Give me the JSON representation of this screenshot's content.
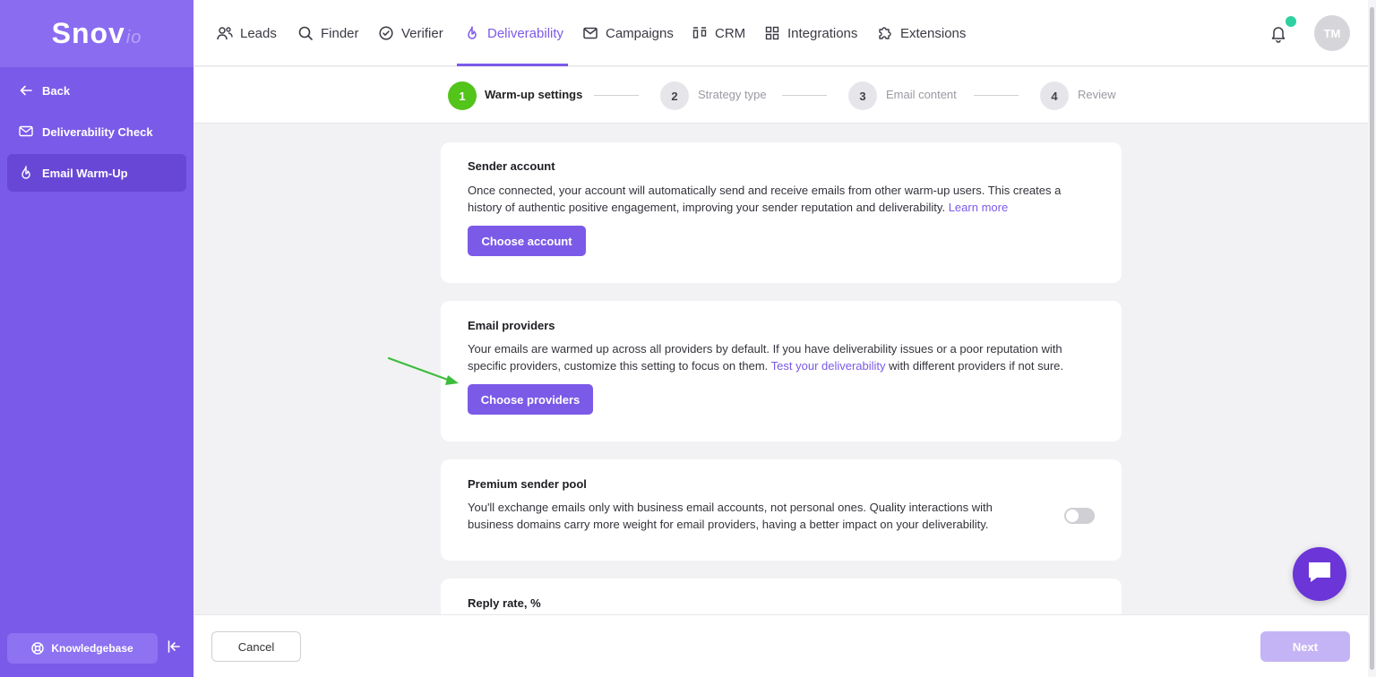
{
  "sidebar": {
    "logo_main": "Snov",
    "logo_suffix": "io",
    "items": [
      {
        "label": "Back",
        "icon": "arrow-left-icon"
      },
      {
        "label": "Deliverability Check",
        "icon": "mail-check-icon"
      },
      {
        "label": "Email Warm-Up",
        "icon": "flame-icon"
      }
    ],
    "knowledgebase_label": "Knowledgebase"
  },
  "nav": {
    "items": [
      {
        "label": "Leads",
        "icon": "users-icon"
      },
      {
        "label": "Finder",
        "icon": "search-icon"
      },
      {
        "label": "Verifier",
        "icon": "check-circle-icon"
      },
      {
        "label": "Deliverability",
        "icon": "flame-icon"
      },
      {
        "label": "Campaigns",
        "icon": "mail-icon"
      },
      {
        "label": "CRM",
        "icon": "crm-icon"
      },
      {
        "label": "Integrations",
        "icon": "grid-icon"
      },
      {
        "label": "Extensions",
        "icon": "puzzle-icon"
      }
    ],
    "active": "Deliverability",
    "avatar_initials": "TM"
  },
  "stepper": [
    {
      "number": "1",
      "label": "Warm-up settings"
    },
    {
      "number": "2",
      "label": "Strategy type"
    },
    {
      "number": "3",
      "label": "Email content"
    },
    {
      "number": "4",
      "label": "Review"
    }
  ],
  "sender_account": {
    "title": "Sender account",
    "description": "Once connected, your account will automatically send and receive emails from other warm-up users. This creates a history of authentic positive engagement, improving your sender reputation and deliverability.",
    "link": "Learn more",
    "button": "Choose account"
  },
  "email_providers": {
    "title": "Email providers",
    "description_before": "Your emails are warmed up across all providers by default. If you have deliverability issues or a poor reputation with specific providers, customize this setting to focus on them.",
    "link": "Test your deliverability",
    "description_after": "with different providers if not sure.",
    "button": "Choose providers"
  },
  "premium_pool": {
    "title": "Premium sender pool",
    "description": "You'll exchange emails only with business email accounts, not personal ones. Quality interactions with business domains carry more weight for email providers, having a better impact on your deliverability.",
    "enabled": false
  },
  "reply_rate": {
    "title": "Reply rate, %"
  },
  "footer": {
    "cancel": "Cancel",
    "next": "Next"
  },
  "colors": {
    "accent": "#7b5ae8",
    "sidebar": "#7a5ae8",
    "step_active": "#52c41a",
    "arrow": "#3cbd3c"
  }
}
